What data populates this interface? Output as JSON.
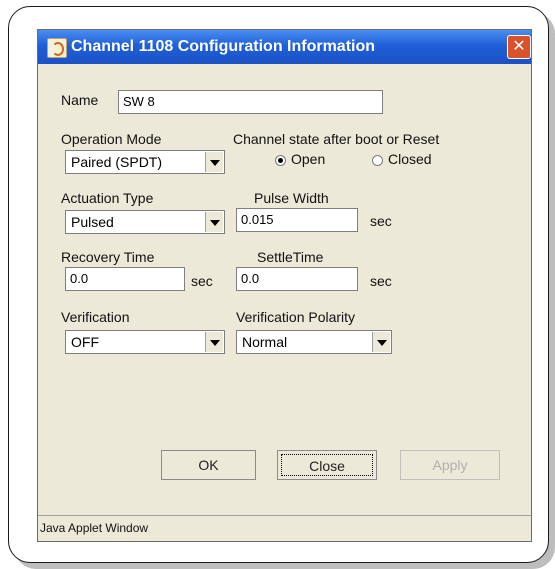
{
  "window": {
    "title": "Channel 1108 Configuration Information",
    "close_symbol": "✕",
    "status_bar": "Java Applet Window"
  },
  "form": {
    "name_label": "Name",
    "name_value": "SW 8",
    "operation_mode_label": "Operation Mode",
    "operation_mode_value": "Paired (SPDT)",
    "channel_state_label": "Channel state after boot or Reset",
    "state_open_label": "Open",
    "state_closed_label": "Closed",
    "state_selected": "Open",
    "actuation_type_label": "Actuation Type",
    "actuation_type_value": "Pulsed",
    "pulse_width_label": "Pulse Width",
    "pulse_width_value": "0.015",
    "pulse_width_unit": "sec",
    "recovery_time_label": "Recovery Time",
    "recovery_time_value": "0.0",
    "recovery_time_unit": "sec",
    "settle_time_label": "SettleTime",
    "settle_time_value": "0.0",
    "settle_time_unit": "sec",
    "verification_label": "Verification",
    "verification_value": "OFF",
    "verification_polarity_label": "Verification Polarity",
    "verification_polarity_value": "Normal"
  },
  "buttons": {
    "ok": "OK",
    "close": "Close",
    "apply": "Apply"
  }
}
